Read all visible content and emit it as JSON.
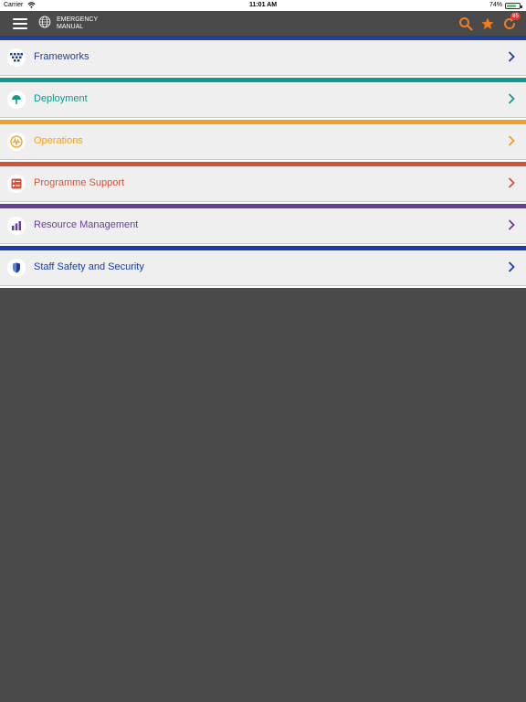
{
  "status_bar": {
    "carrier": "Carrier",
    "time": "11:01 AM",
    "battery": "74%",
    "battery_level": 0.74
  },
  "app_bar": {
    "brand_line1": "EMERGENCY",
    "brand_line2": "MANUAL",
    "notification_count": "85",
    "accent_color": "#f07d1e"
  },
  "menu": {
    "items": [
      {
        "label": "Frameworks",
        "color": "#1f3f9c",
        "icon": "frameworks-icon"
      },
      {
        "label": "Deployment",
        "color": "#11998e",
        "icon": "parachute-icon"
      },
      {
        "label": "Operations",
        "color": "#f0a028",
        "icon": "pulse-icon"
      },
      {
        "label": "Programme Support",
        "color": "#d4533a",
        "icon": "checklist-icon"
      },
      {
        "label": "Resource Management",
        "color": "#6a3c9a",
        "icon": "bar-chart-icon"
      },
      {
        "label": "Staff Safety and Security",
        "color": "#173ea6",
        "icon": "shield-icon"
      }
    ]
  }
}
